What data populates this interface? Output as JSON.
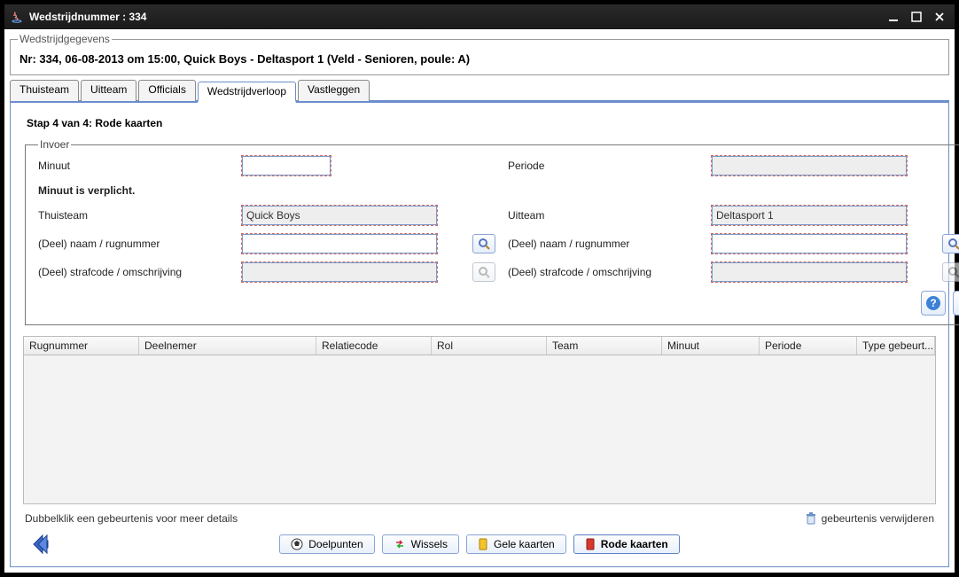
{
  "window": {
    "title": "Wedstrijdnummer : 334"
  },
  "header": {
    "group_label": "Wedstrijdgegevens",
    "line": "Nr: 334, 06-08-2013 om 15:00, Quick Boys - Deltasport 1 (Veld - Senioren, poule: A)"
  },
  "tabs": {
    "thuisteam": "Thuisteam",
    "uitteam": "Uitteam",
    "officials": "Officials",
    "wedstrijdverloop": "Wedstrijdverloop",
    "vastleggen": "Vastleggen"
  },
  "step": "Stap 4 van 4: Rode kaarten",
  "invoer": {
    "legend": "Invoer",
    "minuut_label": "Minuut",
    "minuut_value": "",
    "periode_label": "Periode",
    "periode_value": "",
    "minuut_required": "Minuut is verplicht.",
    "thuisteam_label": "Thuisteam",
    "thuisteam_value": "Quick Boys",
    "uitteam_label": "Uitteam",
    "uitteam_value": "Deltasport 1",
    "naam_label": "(Deel) naam / rugnummer",
    "strafcode_label": "(Deel) strafcode / omschrijving"
  },
  "table": {
    "columns": {
      "rugnummer": "Rugnummer",
      "deelnemer": "Deelnemer",
      "relatiecode": "Relatiecode",
      "rol": "Rol",
      "team": "Team",
      "minuut": "Minuut",
      "periode": "Periode",
      "type": "Type gebeurt..."
    }
  },
  "hints": {
    "dblclick": "Dubbelklik een gebeurtenis voor meer details",
    "delete": "gebeurtenis verwijderen"
  },
  "nav": {
    "doelpunten": "Doelpunten",
    "wissels": "Wissels",
    "gele": "Gele kaarten",
    "rode": "Rode kaarten"
  }
}
